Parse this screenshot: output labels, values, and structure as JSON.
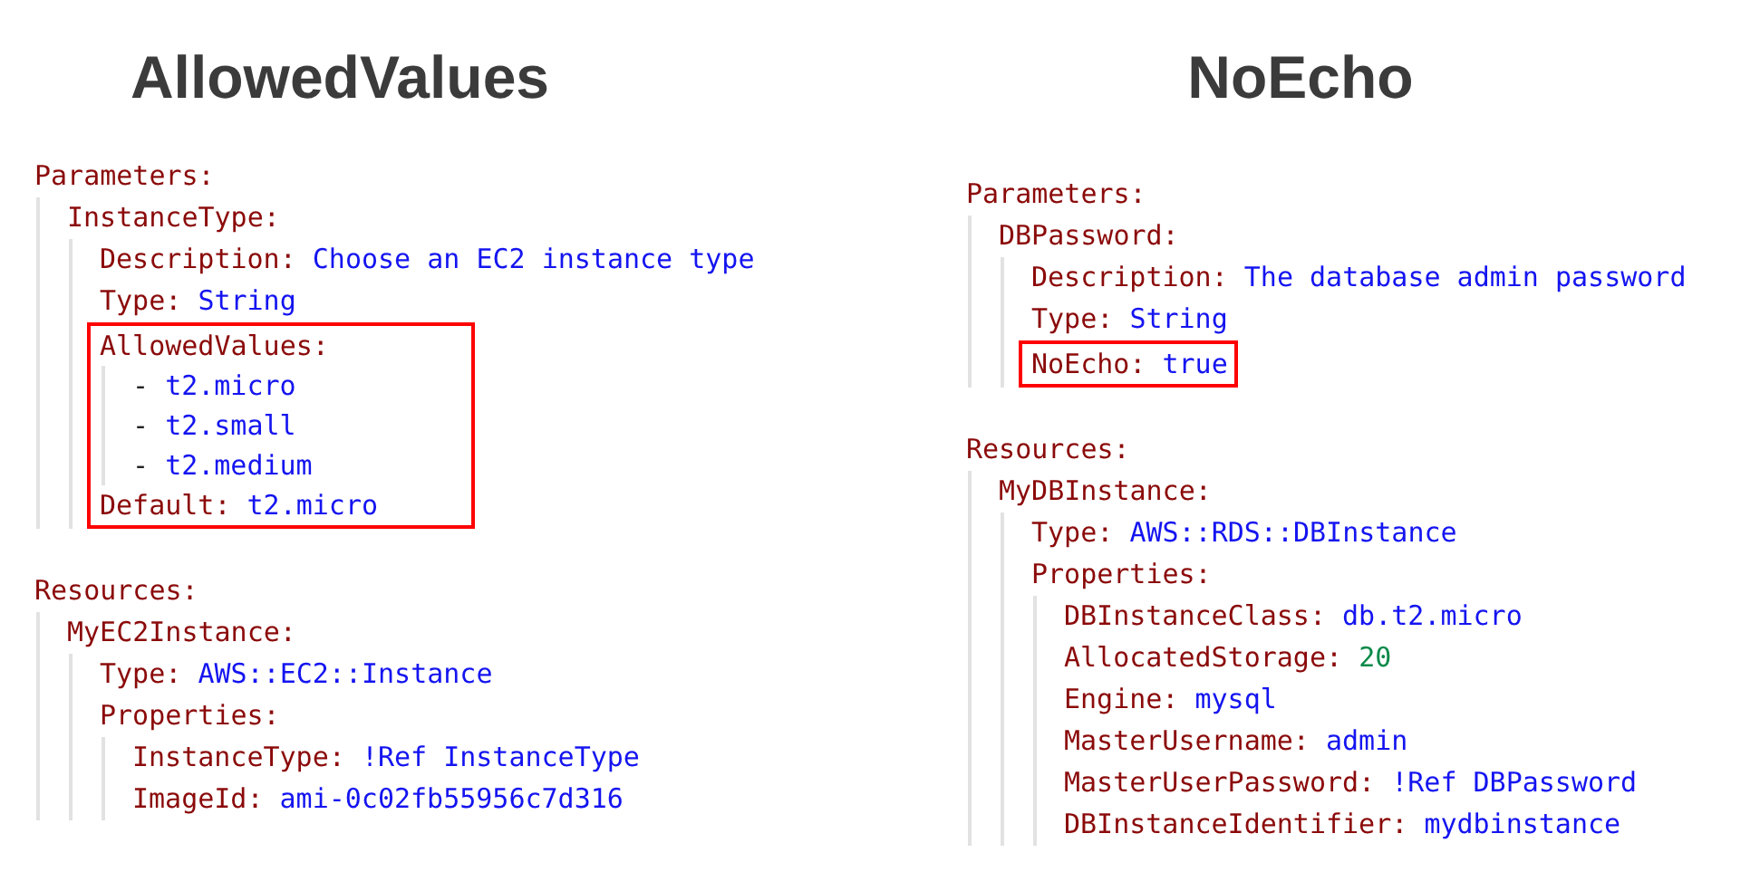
{
  "panels": [
    {
      "title": "AllowedValues",
      "blocks": [
        {
          "kind": "pair",
          "key": "Parameters:",
          "children": [
            {
              "kind": "pair",
              "key": "InstanceType:",
              "children": [
                {
                  "kind": "pair",
                  "key": "Description:",
                  "value": "Choose an EC2 instance type",
                  "numeric": false
                },
                {
                  "kind": "pair",
                  "key": "Type:",
                  "value": "String",
                  "numeric": false
                },
                {
                  "kind": "highlight",
                  "children": [
                    {
                      "kind": "pair",
                      "key": "AllowedValues:",
                      "children": [
                        {
                          "kind": "list_item",
                          "marker": "-",
                          "value": "t2.micro",
                          "numeric": false
                        },
                        {
                          "kind": "list_item",
                          "marker": "-",
                          "value": "t2.small",
                          "numeric": false
                        },
                        {
                          "kind": "list_item",
                          "marker": "-",
                          "value": "t2.medium",
                          "numeric": false
                        }
                      ]
                    },
                    {
                      "kind": "pair",
                      "key": "Default:",
                      "value": "t2.micro",
                      "numeric": false
                    }
                  ]
                }
              ]
            }
          ]
        },
        {
          "kind": "pair",
          "key": "Resources:",
          "children": [
            {
              "kind": "pair",
              "key": "MyEC2Instance:",
              "children": [
                {
                  "kind": "pair",
                  "key": "Type:",
                  "value": "AWS::EC2::Instance",
                  "numeric": false
                },
                {
                  "kind": "pair",
                  "key": "Properties:",
                  "children": [
                    {
                      "kind": "pair",
                      "key": "InstanceType:",
                      "value": "!Ref InstanceType",
                      "numeric": false
                    },
                    {
                      "kind": "pair",
                      "key": "ImageId:",
                      "value": "ami-0c02fb55956c7d316",
                      "numeric": false
                    }
                  ]
                }
              ]
            }
          ]
        }
      ]
    },
    {
      "title": "NoEcho",
      "blocks": [
        {
          "kind": "pair",
          "key": "Parameters:",
          "children": [
            {
              "kind": "pair",
              "key": "DBPassword:",
              "children": [
                {
                  "kind": "pair",
                  "key": "Description:",
                  "value": "The database admin password",
                  "numeric": false
                },
                {
                  "kind": "pair",
                  "key": "Type:",
                  "value": "String",
                  "numeric": false
                },
                {
                  "kind": "highlight",
                  "children": [
                    {
                      "kind": "pair",
                      "key": "NoEcho:",
                      "value": "true",
                      "numeric": false
                    }
                  ]
                }
              ]
            }
          ]
        },
        {
          "kind": "pair",
          "key": "Resources:",
          "children": [
            {
              "kind": "pair",
              "key": "MyDBInstance:",
              "children": [
                {
                  "kind": "pair",
                  "key": "Type:",
                  "value": "AWS::RDS::DBInstance",
                  "numeric": false
                },
                {
                  "kind": "pair",
                  "key": "Properties:",
                  "children": [
                    {
                      "kind": "pair",
                      "key": "DBInstanceClass:",
                      "value": "db.t2.micro",
                      "numeric": false
                    },
                    {
                      "kind": "pair",
                      "key": "AllocatedStorage:",
                      "value": "20",
                      "numeric": true
                    },
                    {
                      "kind": "pair",
                      "key": "Engine:",
                      "value": "mysql",
                      "numeric": false
                    },
                    {
                      "kind": "pair",
                      "key": "MasterUsername:",
                      "value": "admin",
                      "numeric": false
                    },
                    {
                      "kind": "pair",
                      "key": "MasterUserPassword:",
                      "value": "!Ref DBPassword",
                      "numeric": false
                    },
                    {
                      "kind": "pair",
                      "key": "DBInstanceIdentifier:",
                      "value": "mydbinstance",
                      "numeric": false
                    }
                  ]
                }
              ]
            }
          ]
        }
      ]
    }
  ]
}
